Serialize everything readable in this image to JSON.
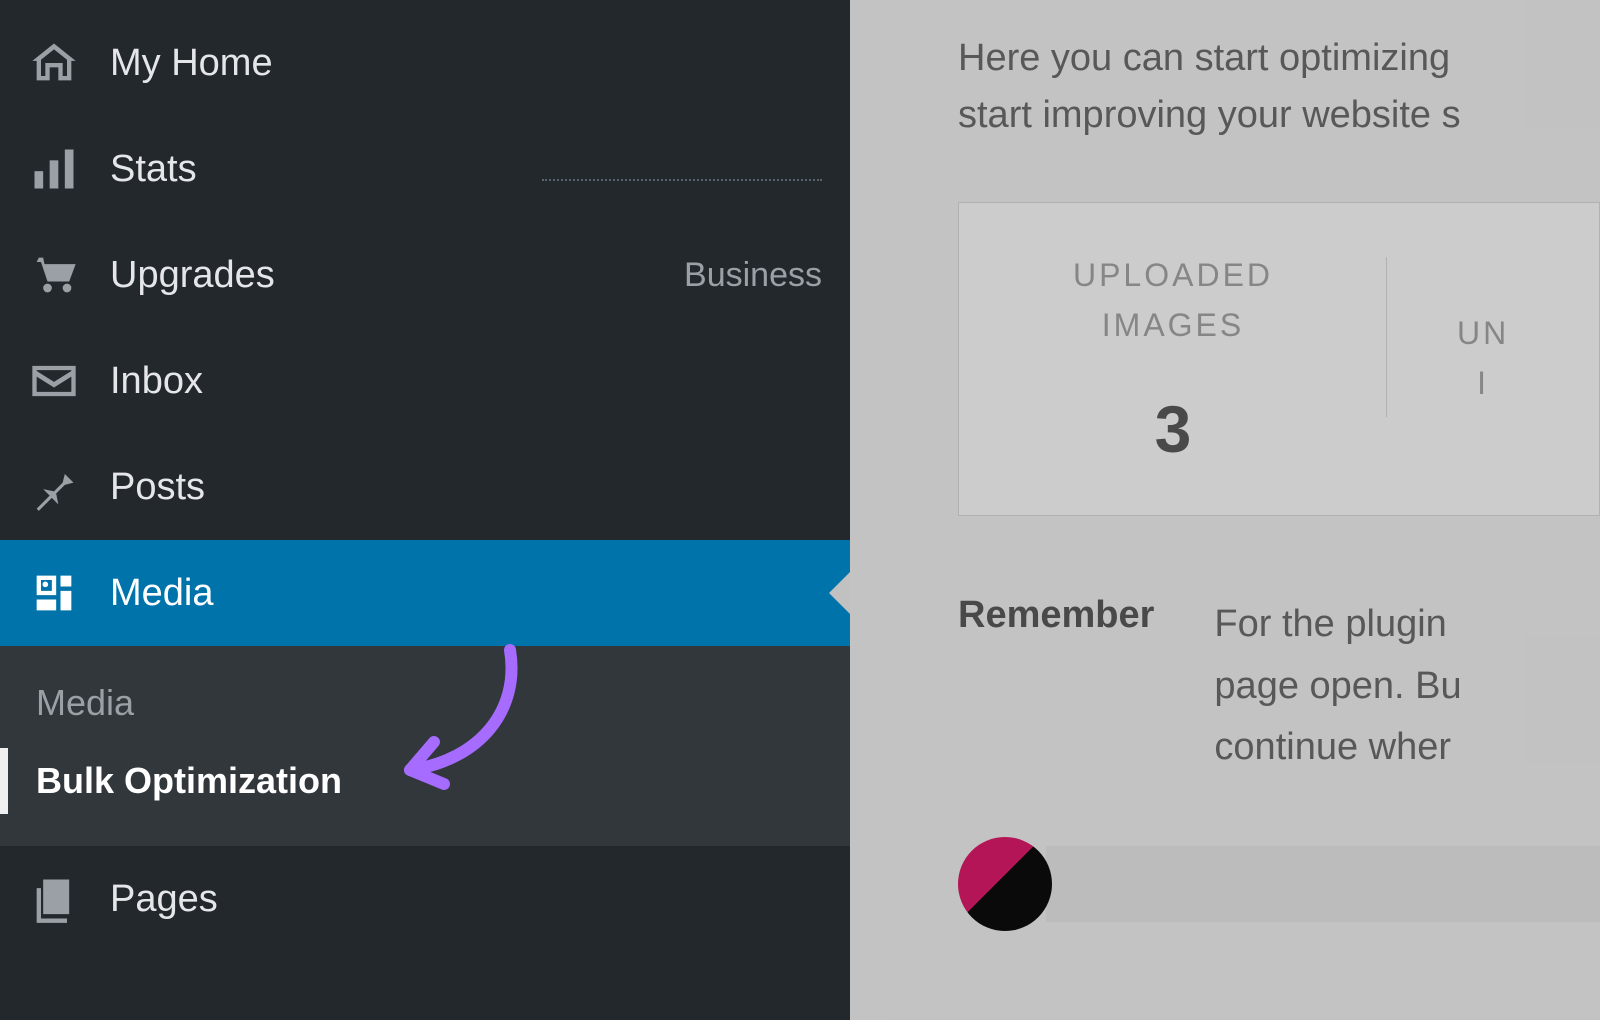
{
  "sidebar": {
    "items": [
      {
        "label": "My Home"
      },
      {
        "label": "Stats"
      },
      {
        "label": "Upgrades",
        "meta": "Business"
      },
      {
        "label": "Inbox"
      },
      {
        "label": "Posts"
      },
      {
        "label": "Media"
      },
      {
        "label": "Pages"
      }
    ],
    "submenu": {
      "header": "Media",
      "current": "Bulk Optimization"
    }
  },
  "main": {
    "intro_line1": "Here you can start optimizing",
    "intro_line2": "start improving your website s",
    "stats": {
      "uploaded_label": "UPLOADED IMAGES",
      "uploaded_value": "3",
      "second_label_partial": "UN",
      "second_label_partial2": "I"
    },
    "remember_label": "Remember",
    "remember_line1": "For the plugin",
    "remember_line2": "page open. Bu",
    "remember_line3": "continue wher"
  }
}
